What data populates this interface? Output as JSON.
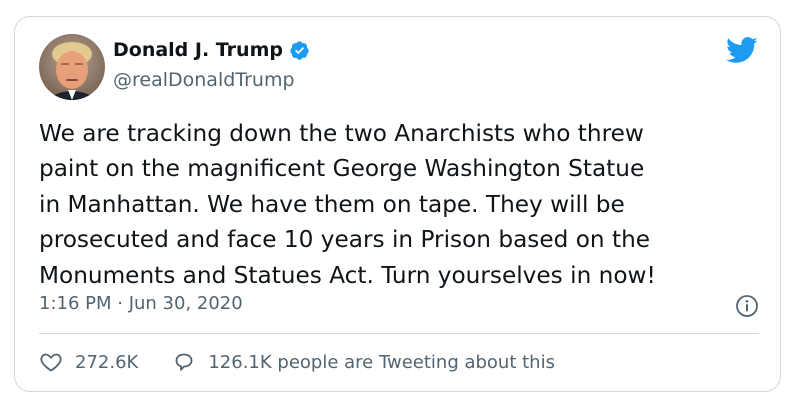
{
  "author": {
    "name": "Donald J. Trump",
    "handle": "@realDonaldTrump",
    "verified": true,
    "avatar_icon": "profile-photo"
  },
  "tweet": {
    "text": "We are tracking down the two Anarchists who threw\npaint on the magnificent George Washington Statue\nin Manhattan. We have them on tape. They will be\nprosecuted and face 10 years in Prison based on the\nMonuments and Statues Act. Turn yourselves in now!",
    "timestamp": "1:16 PM · Jun 30, 2020"
  },
  "engagement": {
    "likes": "272.6K",
    "tweeting": "126.1K people are Tweeting about this"
  },
  "icons": {
    "brand": "twitter-bird-icon",
    "verified": "verified-badge-icon",
    "info": "info-icon",
    "like": "heart-icon",
    "reply": "speech-bubble-icon"
  },
  "colors": {
    "brand_blue": "#1d9bf0",
    "text_primary": "#0f1419",
    "text_secondary": "#536471",
    "border": "#cfd9de"
  }
}
